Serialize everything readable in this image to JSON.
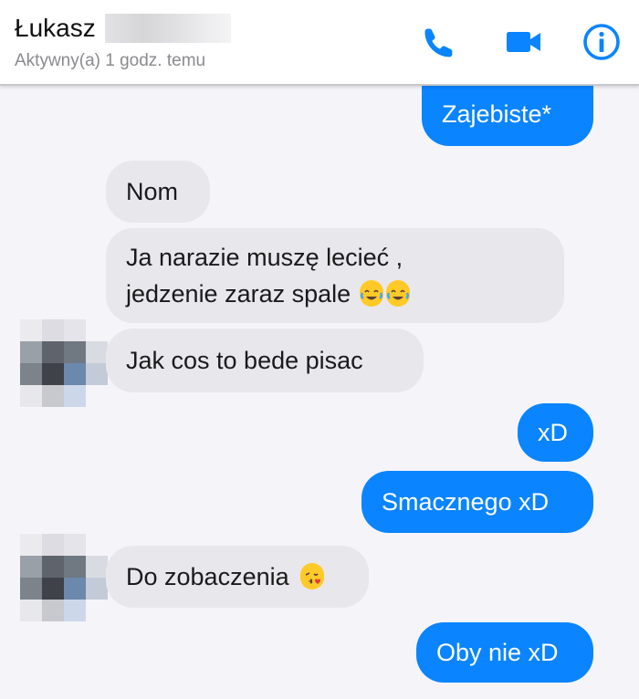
{
  "header": {
    "contact_name": "Łukasz",
    "status": "Aktywny(a) 1 godz. temu",
    "icons": [
      "phone-icon",
      "video-camera-icon",
      "info-icon"
    ],
    "accent_color": "#0a84ff"
  },
  "messages": [
    {
      "from": "me",
      "text": "Zajebiste*"
    },
    {
      "from": "contact",
      "text": "Nom"
    },
    {
      "from": "contact",
      "line1": "Ja narazie muszę lecieć ,",
      "line2": "jedzenie zaraz spale",
      "emoji": "face-with-tears-of-joy x2"
    },
    {
      "from": "contact",
      "text": "Jak cos to bede pisac"
    },
    {
      "from": "me",
      "text": "xD"
    },
    {
      "from": "me",
      "text": "Smacznego xD"
    },
    {
      "from": "contact",
      "text": "Do zobaczenia",
      "emoji": "face-blowing-a-kiss"
    },
    {
      "from": "me",
      "text": "Oby nie xD"
    }
  ],
  "colors": {
    "sent_bubble": "#0a84ff",
    "received_bubble": "#e8e7ec",
    "background": "#f5f4f9"
  }
}
